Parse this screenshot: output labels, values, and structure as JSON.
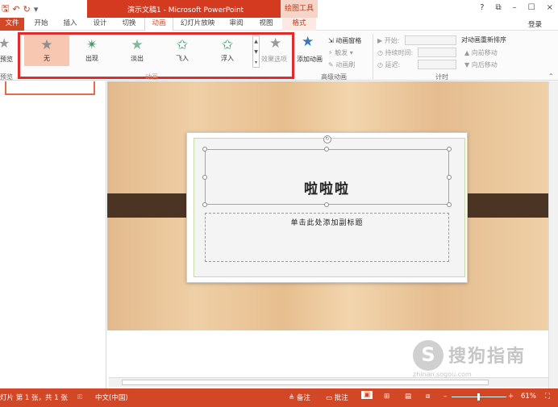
{
  "window": {
    "title": "演示文稿1 - Microsoft PowerPoint",
    "context_tool": "绘图工具",
    "controls": [
      "?",
      "⧉",
      "–",
      "☐",
      "×"
    ]
  },
  "qat": [
    "save-icon",
    "undo-icon",
    "redo-icon",
    "customize-icon"
  ],
  "tabs": [
    {
      "label": "文件"
    },
    {
      "label": "开始"
    },
    {
      "label": "插入"
    },
    {
      "label": "设计"
    },
    {
      "label": "切换"
    },
    {
      "label": "动画"
    },
    {
      "label": "幻灯片放映"
    },
    {
      "label": "审阅"
    },
    {
      "label": "视图"
    },
    {
      "label": "格式"
    }
  ],
  "active_tab": "动画",
  "login": "登录",
  "ribbon": {
    "preview_label": "预览",
    "preview_group": "预览",
    "animations": [
      {
        "label": "无",
        "color": "#9a9a9a"
      },
      {
        "label": "出现",
        "color": "#3d9a6a"
      },
      {
        "label": "淡出",
        "color": "#7fb89a"
      },
      {
        "label": "飞入",
        "color": "#3d9a6a"
      },
      {
        "label": "浮入",
        "color": "#3d9a6a"
      }
    ],
    "effect_options": "效果选项",
    "animation_group": "动画",
    "add_animation": "添加动画",
    "animation_pane": "动画窗格",
    "trigger": "触发",
    "animation_painter": "动画刷",
    "advanced_group": "高级动画",
    "start": "开始:",
    "duration": "持续时间:",
    "delay": "延迟:",
    "timing_group": "计时",
    "reorder": "对动画重新排序",
    "move_earlier": "向前移动",
    "move_later": "向后移动"
  },
  "slide": {
    "title": "啦啦啦",
    "subtitle": "单击此处添加副标题"
  },
  "watermark": {
    "logo": "S",
    "text": "搜狗指南",
    "url": "zhinan.sogou.com"
  },
  "statusbar": {
    "slide_info": "灯片 第 1 张，共 1 张",
    "language": "中文(中国)",
    "notes": "备注",
    "comments": "批注",
    "zoom_minus": "–",
    "zoom_plus": "+",
    "zoom": "61%",
    "zoom_fraction": 0.47
  }
}
